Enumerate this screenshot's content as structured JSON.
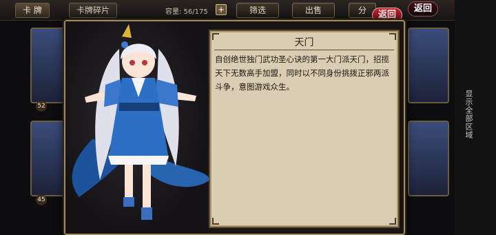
{
  "topbar": {
    "tabs": [
      "卡  牌",
      "卡牌碎片"
    ],
    "capacity_label": "容量: 56/175",
    "capacity_plus": "+",
    "filter_label": "筛选",
    "sell_label": "出售",
    "decompose_label": "分",
    "back_label": "返回",
    "back_label_2": "返回"
  },
  "side": {
    "label": "显示全部区域"
  },
  "background_cards": {
    "numbers": [
      "52",
      "45"
    ]
  },
  "modal": {
    "title": "天门",
    "description": "自创绝世独门武功圣心诀的第一大门派天门，招揽天下无数高手加盟，同时以不同身份挑拨正邪两派斗争，意图游戏众生。"
  },
  "colors": {
    "panel_bg": "#d9cdb4",
    "frame_gold": "#a58a5b",
    "back_red": "#c81e2c",
    "hair_silver": "#e8e6ee",
    "robe_blue": "#2d6fc4"
  }
}
